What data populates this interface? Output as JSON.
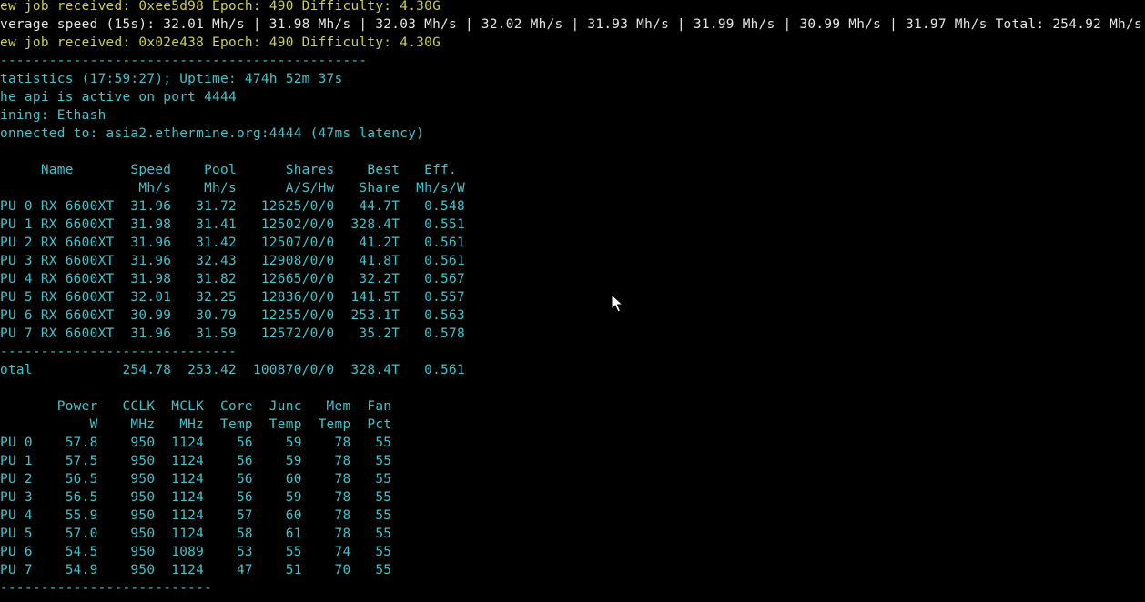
{
  "terminal": {
    "lines": [
      {
        "text": "ew job received: 0xee5d98 Epoch: 490 Difficulty: 4.30G",
        "color": "yellow"
      },
      {
        "text": "verage speed (15s): 32.01 Mh/s | 31.98 Mh/s | 32.03 Mh/s | 32.02 Mh/s | 31.93 Mh/s | 31.99 Mh/s | 30.99 Mh/s | 31.97 Mh/s Total: 254.92 Mh/s",
        "color": "white"
      },
      {
        "text": "ew job received: 0x02e438 Epoch: 490 Difficulty: 4.30G",
        "color": "yellow"
      },
      {
        "text": "---------------------------------------------",
        "color": "cyan"
      },
      {
        "text": "tatistics (17:59:27); Uptime: 474h 52m 37s",
        "color": "cyan"
      },
      {
        "text": "he api is active on port 4444",
        "color": "cyan"
      },
      {
        "text": "ining: Ethash",
        "color": "cyan"
      },
      {
        "text": "onnected to: asia2.ethermine.org:4444 (47ms latency)",
        "color": "cyan"
      },
      {
        "text": "",
        "color": "cyan"
      },
      {
        "text": "     Name       Speed    Pool      Shares    Best   Eff.",
        "color": "cyan"
      },
      {
        "text": "                 Mh/s    Mh/s      A/S/Hw   Share  Mh/s/W",
        "color": "cyan"
      },
      {
        "text": "PU 0 RX 6600XT  31.96   31.72   12625/0/0   44.7T   0.548",
        "color": "cyan"
      },
      {
        "text": "PU 1 RX 6600XT  31.98   31.41   12502/0/0  328.4T   0.551",
        "color": "cyan"
      },
      {
        "text": "PU 2 RX 6600XT  31.96   31.42   12507/0/0   41.2T   0.561",
        "color": "cyan"
      },
      {
        "text": "PU 3 RX 6600XT  31.96   32.43   12908/0/0   41.8T   0.561",
        "color": "cyan"
      },
      {
        "text": "PU 4 RX 6600XT  31.98   31.82   12665/0/0   32.2T   0.567",
        "color": "cyan"
      },
      {
        "text": "PU 5 RX 6600XT  32.01   32.25   12836/0/0  141.5T   0.557",
        "color": "cyan"
      },
      {
        "text": "PU 6 RX 6600XT  30.99   30.79   12255/0/0  253.1T   0.563",
        "color": "cyan"
      },
      {
        "text": "PU 7 RX 6600XT  31.96   31.59   12572/0/0   35.2T   0.578",
        "color": "cyan"
      },
      {
        "text": "-----------------------------",
        "color": "cyan"
      },
      {
        "text": "otal           254.78  253.42  100870/0/0  328.4T   0.561",
        "color": "cyan"
      },
      {
        "text": "",
        "color": "cyan"
      },
      {
        "text": "       Power   CCLK  MCLK  Core  Junc   Mem  Fan",
        "color": "cyan"
      },
      {
        "text": "           W    MHz   MHz  Temp  Temp  Temp  Pct",
        "color": "cyan"
      },
      {
        "text": "PU 0    57.8    950  1124    56    59    78   55",
        "color": "cyan"
      },
      {
        "text": "PU 1    57.5    950  1124    56    59    78   55",
        "color": "cyan"
      },
      {
        "text": "PU 2    56.5    950  1124    56    60    78   55",
        "color": "cyan"
      },
      {
        "text": "PU 3    56.5    950  1124    56    59    78   55",
        "color": "cyan"
      },
      {
        "text": "PU 4    55.9    950  1124    57    60    78   55",
        "color": "cyan"
      },
      {
        "text": "PU 5    57.0    950  1124    58    61    78   55",
        "color": "cyan"
      },
      {
        "text": "PU 6    54.5    950  1089    53    55    74   55",
        "color": "cyan"
      },
      {
        "text": "PU 7    54.9    950  1124    47    51    70   55",
        "color": "cyan"
      },
      {
        "text": "--------------------------",
        "color": "cyan"
      }
    ]
  },
  "colors": {
    "background": "#000000",
    "yellow": "#cfcf4e",
    "white": "#e6e6e6",
    "cyan": "#3fc4cc"
  },
  "icons": {
    "cursor": "mouse-pointer-icon"
  }
}
